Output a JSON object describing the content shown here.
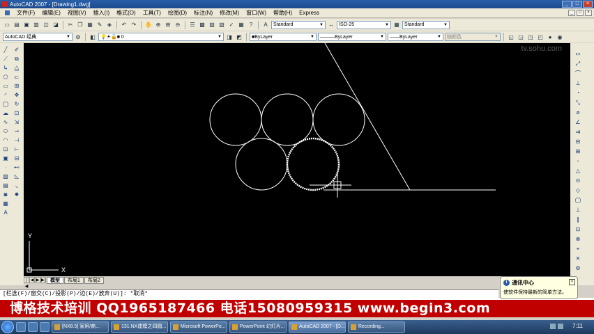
{
  "window": {
    "title": "AutoCAD 2007 - [Drawing1.dwg]",
    "buttons": [
      "_",
      "□",
      "×"
    ]
  },
  "menu": {
    "items": [
      "文件(F)",
      "编辑(E)",
      "视图(V)",
      "插入(I)",
      "格式(O)",
      "工具(T)",
      "绘图(D)",
      "标注(N)",
      "修改(M)",
      "窗口(W)",
      "帮助(H)",
      "Express"
    ]
  },
  "toolbar": {
    "text_style": "Standard",
    "dim_style": "ISO-25",
    "table_style": "Standard",
    "workspace": "AutoCAD 经典",
    "layer": "0",
    "color": "ByLayer",
    "linetype": "ByLayer",
    "lineweight": "ByLayer",
    "plot_style": "随颜色"
  },
  "canvas": {
    "background": "#000000",
    "watermark": "tv.sohu.com",
    "ucs_x": "X",
    "ucs_y": "Y"
  },
  "layout_tabs": {
    "nav": [
      "|◀",
      "◀",
      "▶",
      "▶|"
    ],
    "tabs": [
      "模型",
      "布局1",
      "布局2"
    ],
    "active": "模型"
  },
  "command_line": {
    "text": "[栏选(F)/窗交(C)/投影(P)/边(E)/放弃(U)]: *取消*"
  },
  "notification": {
    "title": "通讯中心",
    "body": "使软件保持最新的简单方法。",
    "close": "×"
  },
  "banner": {
    "text": "博格技术培训  QQ1965187466  电话15080959315  www.begin3.com"
  },
  "taskbar": {
    "tasks": [
      "[NX8.5] 家用/商...",
      "131.NX建模之四圆...",
      "Microsoft PowerPo...",
      "PowerPoint 幻灯片...",
      "AutoCAD 2007 - [D...",
      "Recording..."
    ],
    "active_index": 4,
    "clock": "7:11"
  }
}
